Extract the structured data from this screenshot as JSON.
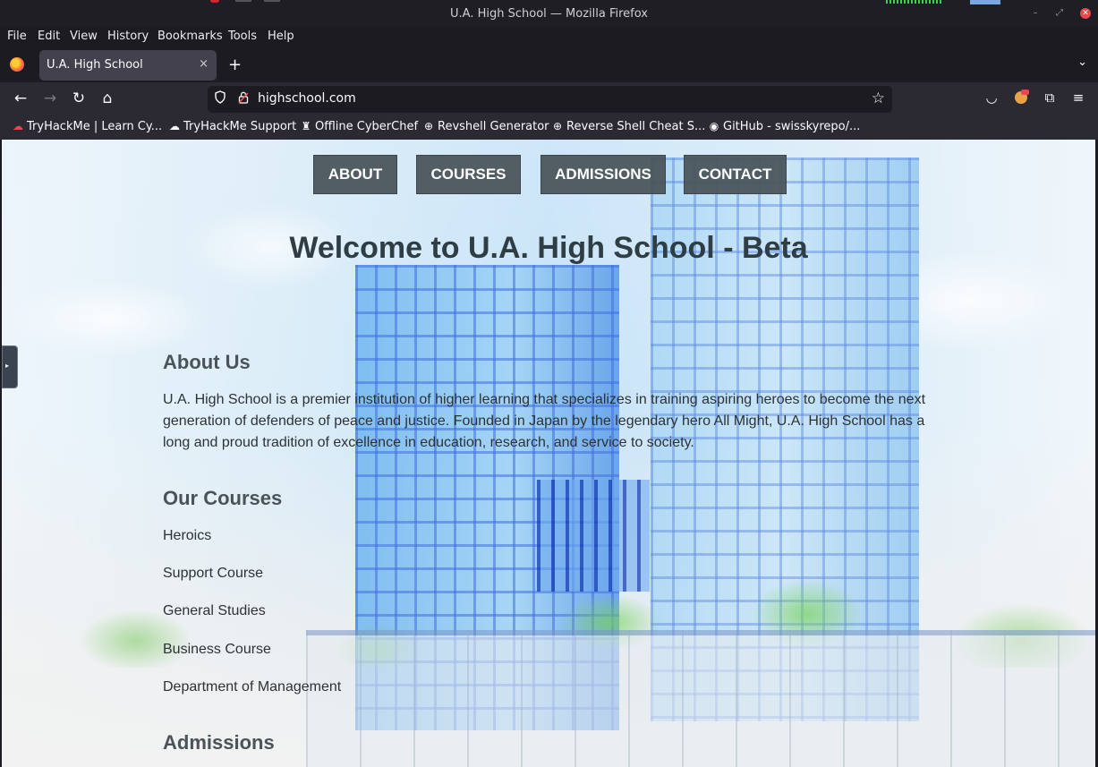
{
  "window": {
    "title": "U.A. High School — Mozilla Firefox"
  },
  "menu": [
    "File",
    "Edit",
    "View",
    "History",
    "Bookmarks",
    "Tools",
    "Help"
  ],
  "tab": {
    "label": "U.A. High School",
    "close": "×",
    "new_tab": "+"
  },
  "address_bar": {
    "url": "highschool.com"
  },
  "bookmarks": [
    {
      "label": "TryHackMe | Learn Cy...",
      "icon": "tryhackme-cloud-icon"
    },
    {
      "label": "TryHackMe Support",
      "icon": "support-icon"
    },
    {
      "label": "Offline CyberChef",
      "icon": "chef-icon"
    },
    {
      "label": "Revshell Generator",
      "icon": "globe-icon"
    },
    {
      "label": "Reverse Shell Cheat S...",
      "icon": "globe-icon"
    },
    {
      "label": "GitHub - swisskyrepo/...",
      "icon": "github-icon"
    }
  ],
  "site": {
    "nav": [
      "ABOUT",
      "COURSES",
      "ADMISSIONS",
      "CONTACT"
    ],
    "heading": "Welcome to U.A. High School - Beta",
    "about": {
      "title": "About Us",
      "text": "U.A. High School is a premier institution of higher learning that specializes in training aspiring heroes to become the next generation of defenders of peace and justice. Founded in Japan by the legendary hero All Might, U.A. High School has a long and proud tradition of excellence in education, research, and service to society."
    },
    "courses": {
      "title": "Our Courses",
      "items": [
        "Heroics",
        "Support Course",
        "General Studies",
        "Business Course",
        "Department of Management"
      ]
    },
    "admissions": {
      "title": "Admissions"
    }
  },
  "colors": {
    "nav_button_bg": "#4b555c",
    "heading_color": "#2f3d45",
    "browser_chrome": "#2b2a33"
  }
}
